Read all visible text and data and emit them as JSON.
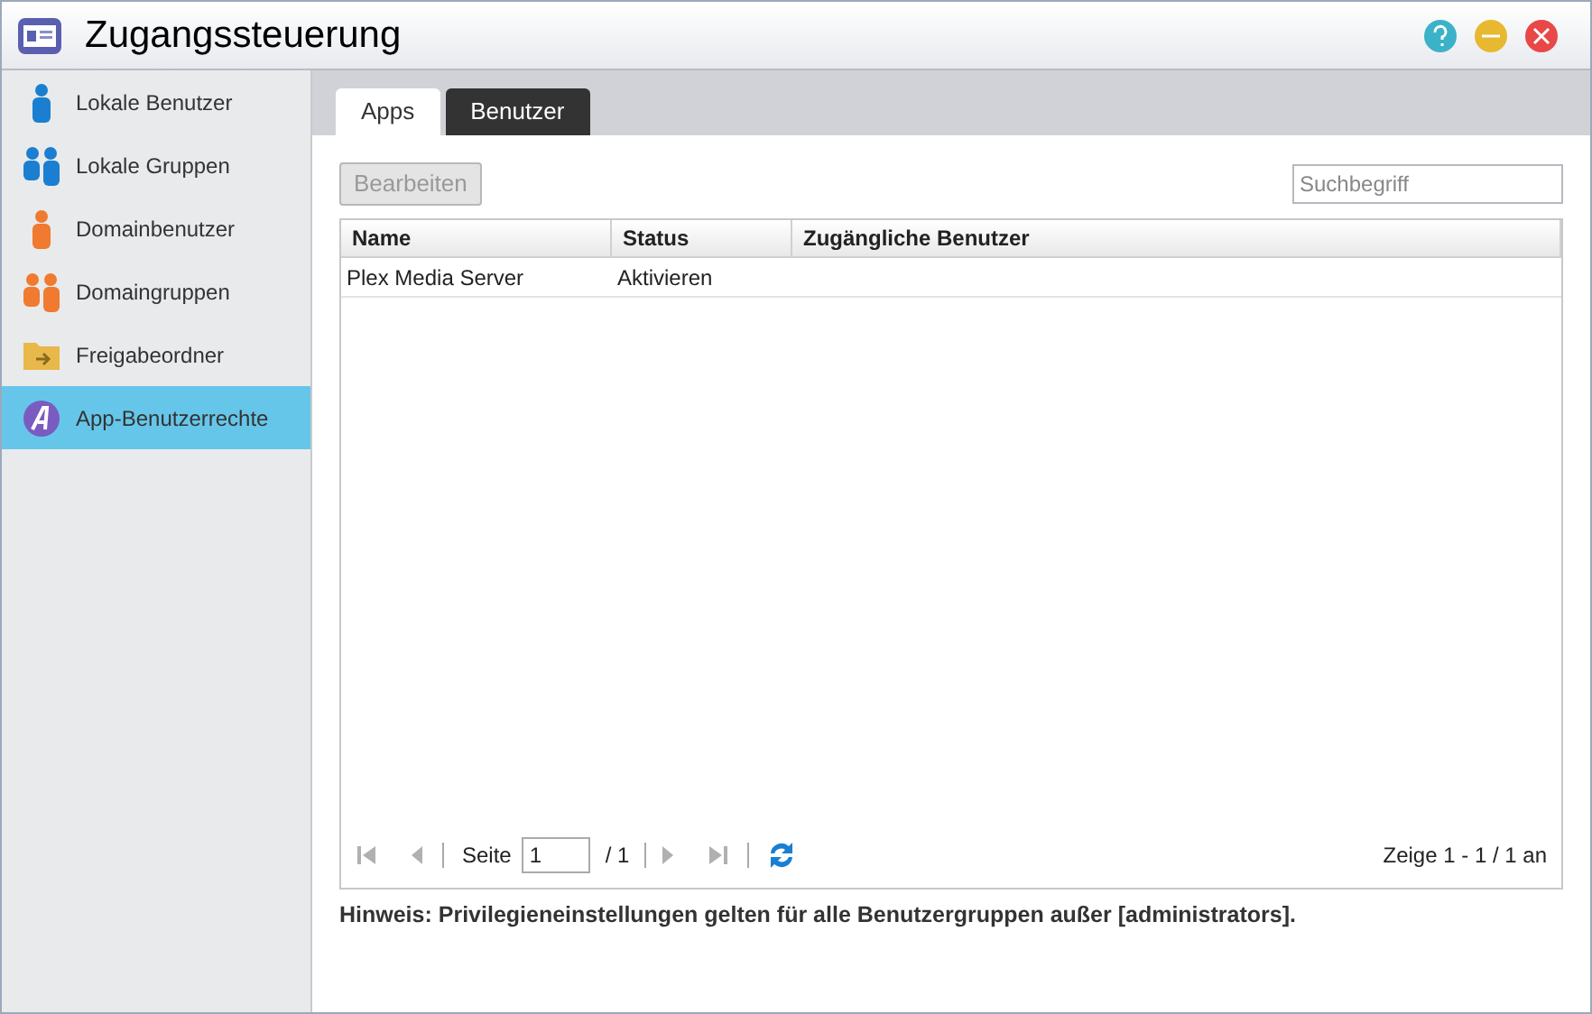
{
  "window": {
    "title": "Zugangssteuerung"
  },
  "sidebar": {
    "items": [
      {
        "label": "Lokale Benutzer",
        "kind": "user",
        "color": "#1a7fd0",
        "selected": false
      },
      {
        "label": "Lokale Gruppen",
        "kind": "group",
        "color": "#1a7fd0",
        "selected": false
      },
      {
        "label": "Domainbenutzer",
        "kind": "user",
        "color": "#f07a30",
        "selected": false
      },
      {
        "label": "Domaingruppen",
        "kind": "group",
        "color": "#f07a30",
        "selected": false
      },
      {
        "label": "Freigabeordner",
        "kind": "folder",
        "color": "#e8b84a",
        "selected": false
      },
      {
        "label": "App-Benutzerrechte",
        "kind": "app",
        "color": "#7a5cc0",
        "selected": true
      }
    ]
  },
  "tabs": [
    {
      "label": "Apps",
      "selected": true
    },
    {
      "label": "Benutzer",
      "selected": false
    }
  ],
  "toolbar": {
    "edit_button": {
      "label": "Bearbeiten",
      "disabled": true
    },
    "search": {
      "placeholder": "Suchbegriff"
    }
  },
  "table": {
    "columns": [
      "Name",
      "Status",
      "Zugängliche Benutzer"
    ],
    "rows": [
      [
        "Plex Media Server",
        "Aktivieren",
        ""
      ]
    ]
  },
  "pager": {
    "page_label": "Seite",
    "page": "1",
    "total": "/ 1",
    "summary": "Zeige 1 - 1 / 1 an"
  },
  "note": "Hinweis: Privilegieneinstellungen gelten für alle Benutzergruppen außer [administrators]."
}
